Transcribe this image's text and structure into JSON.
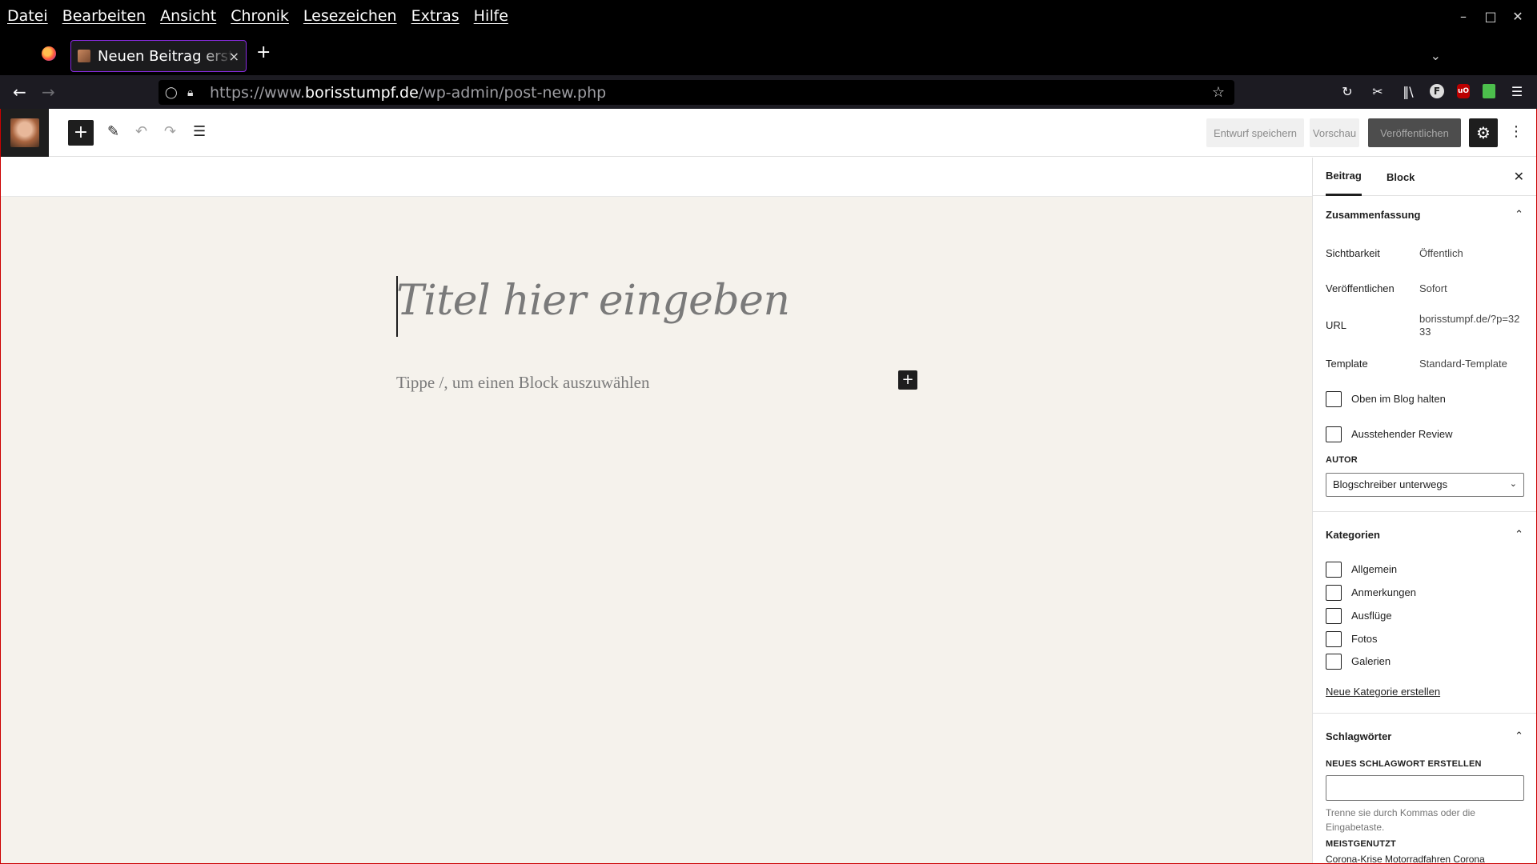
{
  "browser": {
    "menu": [
      "Datei",
      "Bearbeiten",
      "Ansicht",
      "Chronik",
      "Lesezeichen",
      "Extras",
      "Hilfe"
    ],
    "tab_title": "Neuen Beitrag erstellen",
    "tab_close": "×",
    "new_tab": "+",
    "url_host": "borisstumpf.de",
    "url_prefix": "https://www.",
    "url_path": "/wp-admin/post-new.php"
  },
  "editor": {
    "title_placeholder": "Titel hier eingeben",
    "block_placeholder": "Tippe /, um einen Block auszuwählen",
    "buttons": {
      "save_draft": "Entwurf speichern",
      "preview": "Vorschau",
      "publish": "Veröffentlichen"
    }
  },
  "sidebar": {
    "tabs": [
      "Beitrag",
      "Block"
    ],
    "summary": {
      "heading": "Zusammenfassung",
      "rows": [
        {
          "label": "Sichtbarkeit",
          "value": "Öffentlich"
        },
        {
          "label": "Veröffentlichen",
          "value": "Sofort"
        },
        {
          "label": "URL",
          "value": "borisstumpf.de/?p=3233"
        },
        {
          "label": "Template",
          "value": "Standard-Template"
        }
      ],
      "sticky_label": "Oben im Blog halten",
      "review_label": "Ausstehender Review",
      "author_label": "AUTOR",
      "author_value": "Blogschreiber unterwegs"
    },
    "categories": {
      "heading": "Kategorien",
      "items": [
        "Allgemein",
        "Anmerkungen",
        "Ausflüge",
        "Fotos",
        "Galerien"
      ],
      "new_link": "Neue Kategorie erstellen"
    },
    "tags": {
      "heading": "Schlagwörter",
      "new_label": "NEUES SCHLAGWORT ERSTELLEN",
      "help": "Trenne sie durch Kommas oder die Eingabetaste.",
      "most_used_label": "MEISTGENUTZT",
      "most_used": "Corona-Krise  Motorradfahren  Corona"
    }
  }
}
